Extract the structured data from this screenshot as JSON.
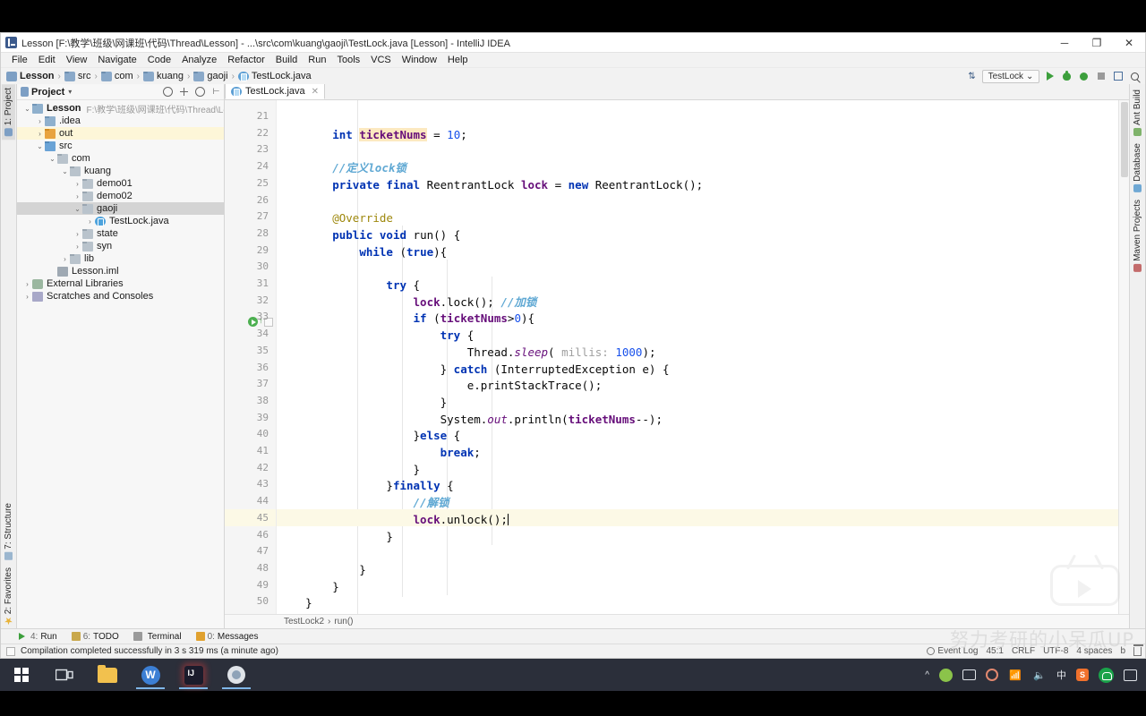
{
  "window": {
    "title": "Lesson [F:\\教学\\班级\\网课班\\代码\\Thread\\Lesson] - ...\\src\\com\\kuang\\gaoji\\TestLock.java [Lesson] - IntelliJ IDEA",
    "app_icon": "intellij-idea-icon",
    "minimize": "─",
    "maximize": "❐",
    "close": "✕"
  },
  "menubar": {
    "items": [
      "File",
      "Edit",
      "View",
      "Navigate",
      "Code",
      "Analyze",
      "Refactor",
      "Build",
      "Run",
      "Tools",
      "VCS",
      "Window",
      "Help"
    ]
  },
  "breadcrumb": {
    "items": [
      {
        "label": "Lesson",
        "icon": "module-icon",
        "bold": true
      },
      {
        "label": "src",
        "icon": "folder-icon",
        "bold": false
      },
      {
        "label": "com",
        "icon": "folder-icon",
        "bold": false
      },
      {
        "label": "kuang",
        "icon": "folder-icon",
        "bold": false
      },
      {
        "label": "gaoji",
        "icon": "folder-icon",
        "bold": false
      },
      {
        "label": "TestLock.java",
        "icon": "java-file-icon",
        "bold": false
      }
    ],
    "separator": "›"
  },
  "toolbar_right": {
    "sort_icon": "sort-icon",
    "run_config": "TestLock",
    "run_config_caret": "⌄",
    "buttons": [
      "run-button",
      "debug-button",
      "run-coverage-button",
      "stop-button",
      "build-project-button",
      "search-everywhere-button"
    ]
  },
  "left_stripe": {
    "top": [
      {
        "label": "1: Project",
        "icon": "project-icon",
        "active": true
      }
    ],
    "bottom": [
      {
        "label": "7: Structure",
        "icon": "structure-icon",
        "active": false
      },
      {
        "label": "2: Favorites",
        "icon": "favorites-icon",
        "active": false
      }
    ]
  },
  "right_stripe": [
    {
      "label": "Ant Build",
      "icon": "ant-icon"
    },
    {
      "label": "Database",
      "icon": "database-icon"
    },
    {
      "label": "Maven Projects",
      "icon": "maven-icon"
    }
  ],
  "project_panel": {
    "title": "Project",
    "caret": "▾",
    "header_icons": [
      "collapse-all-icon",
      "expand-icon",
      "settings-icon",
      "hide-icon"
    ],
    "tree": [
      {
        "depth": 0,
        "arrow": "⌄",
        "icon": "module-icon",
        "label": "Lesson",
        "bold": true,
        "path": "F:\\教学\\班级\\网课班\\代码\\Thread\\Lesson",
        "state": "none"
      },
      {
        "depth": 1,
        "arrow": "›",
        "icon": "folder-blue-icon",
        "label": ".idea",
        "bold": false,
        "path": "",
        "state": "none"
      },
      {
        "depth": 1,
        "arrow": "›",
        "icon": "folder-orange-icon",
        "label": "out",
        "bold": false,
        "path": "",
        "state": "out-highlight"
      },
      {
        "depth": 1,
        "arrow": "⌄",
        "icon": "folder-src-icon",
        "label": "src",
        "bold": false,
        "path": "",
        "state": "none"
      },
      {
        "depth": 2,
        "arrow": "⌄",
        "icon": "folder-gray-icon",
        "label": "com",
        "bold": false,
        "path": "",
        "state": "none"
      },
      {
        "depth": 3,
        "arrow": "⌄",
        "icon": "folder-gray-icon",
        "label": "kuang",
        "bold": false,
        "path": "",
        "state": "none"
      },
      {
        "depth": 4,
        "arrow": "›",
        "icon": "folder-gray-icon",
        "label": "demo01",
        "bold": false,
        "path": "",
        "state": "none"
      },
      {
        "depth": 4,
        "arrow": "›",
        "icon": "folder-gray-icon",
        "label": "demo02",
        "bold": false,
        "path": "",
        "state": "none"
      },
      {
        "depth": 4,
        "arrow": "⌄",
        "icon": "folder-gray-icon",
        "label": "gaoji",
        "bold": false,
        "path": "",
        "state": "selected"
      },
      {
        "depth": 5,
        "arrow": "›",
        "icon": "java-file-icon",
        "label": "TestLock.java",
        "bold": false,
        "path": "",
        "state": "none"
      },
      {
        "depth": 4,
        "arrow": "›",
        "icon": "folder-gray-icon",
        "label": "state",
        "bold": false,
        "path": "",
        "state": "none"
      },
      {
        "depth": 4,
        "arrow": "›",
        "icon": "folder-gray-icon",
        "label": "syn",
        "bold": false,
        "path": "",
        "state": "none"
      },
      {
        "depth": 3,
        "arrow": "›",
        "icon": "folder-gray-icon",
        "label": "lib",
        "bold": false,
        "path": "",
        "state": "none"
      },
      {
        "depth": 2,
        "arrow": "",
        "icon": "iml-file-icon",
        "label": "Lesson.iml",
        "bold": false,
        "path": "",
        "state": "none"
      },
      {
        "depth": 0,
        "arrow": "›",
        "icon": "library-icon",
        "label": "External Libraries",
        "bold": false,
        "path": "",
        "state": "none"
      },
      {
        "depth": 0,
        "arrow": "›",
        "icon": "scratches-icon",
        "label": "Scratches and Consoles",
        "bold": false,
        "path": "",
        "state": "none"
      }
    ]
  },
  "editor": {
    "tabs": [
      {
        "label": "TestLock.java",
        "icon": "java-file-icon",
        "close": "✕",
        "active": true
      }
    ],
    "first_line_number": 21,
    "caret_line": 45,
    "lines": [
      {
        "n": 21,
        "text": ""
      },
      {
        "n": 22,
        "text": "        int ticketNums = 10;",
        "tokens": [
          {
            "t": "        ",
            "c": "plain"
          },
          {
            "t": "int",
            "c": "kw"
          },
          {
            "t": " ",
            "c": "plain"
          },
          {
            "t": "ticketNums",
            "c": "fld-hl"
          },
          {
            "t": " = ",
            "c": "plain"
          },
          {
            "t": "10",
            "c": "num"
          },
          {
            "t": ";",
            "c": "plain"
          }
        ]
      },
      {
        "n": 23,
        "text": ""
      },
      {
        "n": 24,
        "text": "        //定义lock锁",
        "tokens": [
          {
            "t": "        ",
            "c": "plain"
          },
          {
            "t": "//定义lock锁",
            "c": "cmt-cn"
          }
        ]
      },
      {
        "n": 25,
        "text": "        private final ReentrantLock lock = new ReentrantLock();",
        "tokens": [
          {
            "t": "        ",
            "c": "plain"
          },
          {
            "t": "private final",
            "c": "kw"
          },
          {
            "t": " ReentrantLock ",
            "c": "plain"
          },
          {
            "t": "lock",
            "c": "fld"
          },
          {
            "t": " = ",
            "c": "plain"
          },
          {
            "t": "new",
            "c": "kw"
          },
          {
            "t": " ReentrantLock();",
            "c": "plain"
          }
        ]
      },
      {
        "n": 26,
        "text": ""
      },
      {
        "n": 27,
        "text": "        @Override",
        "tokens": [
          {
            "t": "        ",
            "c": "plain"
          },
          {
            "t": "@Override",
            "c": "anno"
          }
        ]
      },
      {
        "n": 28,
        "text": "        public void run() {",
        "tokens": [
          {
            "t": "        ",
            "c": "plain"
          },
          {
            "t": "public void",
            "c": "kw"
          },
          {
            "t": " run() {",
            "c": "plain"
          }
        ]
      },
      {
        "n": 29,
        "text": "            while (true){",
        "tokens": [
          {
            "t": "            ",
            "c": "plain"
          },
          {
            "t": "while",
            "c": "kw"
          },
          {
            "t": " (",
            "c": "plain"
          },
          {
            "t": "true",
            "c": "kw"
          },
          {
            "t": "){",
            "c": "plain"
          }
        ]
      },
      {
        "n": 30,
        "text": ""
      },
      {
        "n": 31,
        "text": "                try {",
        "tokens": [
          {
            "t": "                ",
            "c": "plain"
          },
          {
            "t": "try",
            "c": "kw"
          },
          {
            "t": " {",
            "c": "plain"
          }
        ]
      },
      {
        "n": 32,
        "text": "                    lock.lock(); //加锁",
        "tokens": [
          {
            "t": "                    ",
            "c": "plain"
          },
          {
            "t": "lock",
            "c": "fld"
          },
          {
            "t": ".lock(); ",
            "c": "plain"
          },
          {
            "t": "//加锁",
            "c": "cmt-cn"
          }
        ]
      },
      {
        "n": 33,
        "text": "                    if (ticketNums>0){",
        "tokens": [
          {
            "t": "                    ",
            "c": "plain"
          },
          {
            "t": "if",
            "c": "kw"
          },
          {
            "t": " (",
            "c": "plain"
          },
          {
            "t": "ticketNums",
            "c": "fld"
          },
          {
            "t": ">",
            "c": "plain"
          },
          {
            "t": "0",
            "c": "num"
          },
          {
            "t": "){",
            "c": "plain"
          }
        ]
      },
      {
        "n": 34,
        "text": "                        try {",
        "tokens": [
          {
            "t": "                        ",
            "c": "plain"
          },
          {
            "t": "try",
            "c": "kw"
          },
          {
            "t": " {",
            "c": "plain"
          }
        ]
      },
      {
        "n": 35,
        "text": "                            Thread.sleep( millis: 1000);",
        "tokens": [
          {
            "t": "                            ",
            "c": "plain"
          },
          {
            "t": "Thread.",
            "c": "plain"
          },
          {
            "t": "sleep",
            "c": "stat"
          },
          {
            "t": "( ",
            "c": "plain"
          },
          {
            "t": "millis:",
            "c": "param"
          },
          {
            "t": " ",
            "c": "plain"
          },
          {
            "t": "1000",
            "c": "num"
          },
          {
            "t": ");",
            "c": "plain"
          }
        ]
      },
      {
        "n": 36,
        "text": "                        } catch (InterruptedException e) {",
        "tokens": [
          {
            "t": "                        } ",
            "c": "plain"
          },
          {
            "t": "catch",
            "c": "kw"
          },
          {
            "t": " (InterruptedException e) {",
            "c": "plain"
          }
        ]
      },
      {
        "n": 37,
        "text": "                            e.printStackTrace();",
        "tokens": [
          {
            "t": "                            e.printStackTrace();",
            "c": "plain"
          }
        ]
      },
      {
        "n": 38,
        "text": "                        }",
        "tokens": [
          {
            "t": "                        }",
            "c": "plain"
          }
        ]
      },
      {
        "n": 39,
        "text": "                        System.out.println(ticketNums--);",
        "tokens": [
          {
            "t": "                        System.",
            "c": "plain"
          },
          {
            "t": "out",
            "c": "stat"
          },
          {
            "t": ".println(",
            "c": "plain"
          },
          {
            "t": "ticketNums",
            "c": "fld"
          },
          {
            "t": "--);",
            "c": "plain"
          }
        ]
      },
      {
        "n": 40,
        "text": "                    }else {",
        "tokens": [
          {
            "t": "                    }",
            "c": "plain"
          },
          {
            "t": "else",
            "c": "kw"
          },
          {
            "t": " {",
            "c": "plain"
          }
        ]
      },
      {
        "n": 41,
        "text": "                        break;",
        "tokens": [
          {
            "t": "                        ",
            "c": "plain"
          },
          {
            "t": "break",
            "c": "kw"
          },
          {
            "t": ";",
            "c": "plain"
          }
        ]
      },
      {
        "n": 42,
        "text": "                    }",
        "tokens": [
          {
            "t": "                    }",
            "c": "plain"
          }
        ]
      },
      {
        "n": 43,
        "text": "                }finally {",
        "tokens": [
          {
            "t": "                }",
            "c": "plain"
          },
          {
            "t": "finally",
            "c": "kw"
          },
          {
            "t": " {",
            "c": "plain"
          }
        ]
      },
      {
        "n": 44,
        "text": "                    //解锁",
        "tokens": [
          {
            "t": "                    ",
            "c": "plain"
          },
          {
            "t": "//解锁",
            "c": "cmt-cn"
          }
        ]
      },
      {
        "n": 45,
        "text": "                    lock.unlock();",
        "tokens": [
          {
            "t": "                    ",
            "c": "plain"
          },
          {
            "t": "lock",
            "c": "fld"
          },
          {
            "t": ".unlock();",
            "c": "plain"
          }
        ]
      },
      {
        "n": 46,
        "text": "                }",
        "tokens": [
          {
            "t": "                }",
            "c": "plain"
          }
        ]
      },
      {
        "n": 47,
        "text": ""
      },
      {
        "n": 48,
        "text": "            }",
        "tokens": [
          {
            "t": "            }",
            "c": "plain"
          }
        ]
      },
      {
        "n": 49,
        "text": "        }",
        "tokens": [
          {
            "t": "        }",
            "c": "plain"
          }
        ]
      },
      {
        "n": 50,
        "text": "    }",
        "tokens": [
          {
            "t": "    }",
            "c": "plain"
          }
        ]
      }
    ],
    "gutter_run_marker_line": 28,
    "breadcrumb": {
      "class": "TestLock2",
      "method": "run()",
      "separator": "›"
    }
  },
  "bottom_toolwindows": [
    {
      "num": "4:",
      "label": "Run",
      "icon": "run-icon"
    },
    {
      "num": "6:",
      "label": "TODO",
      "icon": "todo-icon"
    },
    {
      "num": "",
      "label": "Terminal",
      "icon": "terminal-icon"
    },
    {
      "num": "0:",
      "label": "Messages",
      "icon": "messages-icon"
    }
  ],
  "statusbar": {
    "message": "Compilation completed successfully in 3 s 319 ms (a minute ago)",
    "event_log": "Event Log",
    "position": "45:1",
    "line_sep": "CRLF",
    "encoding": "UTF-8",
    "indent": "4 spaces",
    "branch": "b",
    "lock_icon": "lock-icon",
    "trash_icon": "trash-icon"
  },
  "watermark": {
    "text": "努力考研的小呆瓜UP",
    "logo": "bilibili-tv-icon"
  },
  "taskbar": {
    "start": "windows-logo-icon",
    "items": [
      {
        "icon": "task-view-icon",
        "name": "task-view-button",
        "state": "none"
      },
      {
        "icon": "file-explorer-icon",
        "name": "file-explorer-button",
        "state": "none"
      },
      {
        "icon": "wps-icon",
        "name": "wps-button",
        "state": "open"
      },
      {
        "icon": "intellij-idea-icon",
        "name": "intellij-idea-button",
        "state": "active"
      },
      {
        "icon": "browser-icon",
        "name": "browser-button",
        "state": "open"
      }
    ],
    "tray": [
      "show-hidden-icons-caret",
      "shield-icon",
      "monitor-icon",
      "record-icon",
      "network-icon",
      "volume-icon",
      "ime-cn-icon",
      "sogou-icon",
      "wechat-icon",
      "notifications-icon"
    ]
  },
  "colors": {
    "accent": "#4a90d9",
    "run_green": "#3c9f3c",
    "keyword_blue": "#0033b3",
    "field_purple": "#660e7a",
    "comment_cn": "#5fa8d3",
    "number_blue": "#1750eb",
    "highlight_row": "#fcf9e6",
    "taskbar_bg": "#2b2f3a"
  }
}
